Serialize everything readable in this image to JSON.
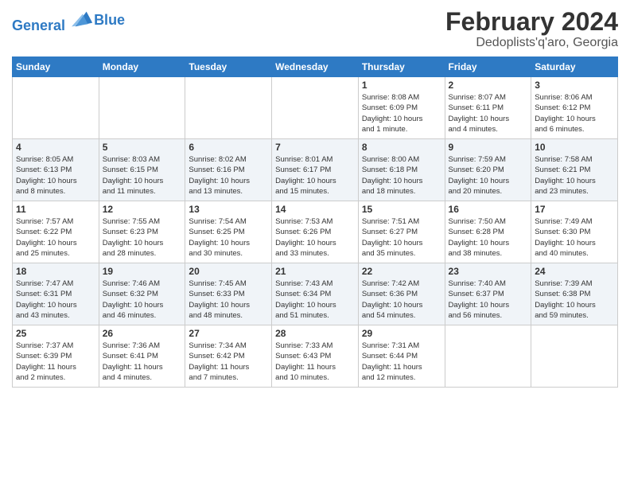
{
  "header": {
    "logo_line1": "General",
    "logo_line2": "Blue",
    "title": "February 2024",
    "subtitle": "Dedoplists'q'aro, Georgia"
  },
  "days_of_week": [
    "Sunday",
    "Monday",
    "Tuesday",
    "Wednesday",
    "Thursday",
    "Friday",
    "Saturday"
  ],
  "weeks": [
    [
      {
        "day": "",
        "info": ""
      },
      {
        "day": "",
        "info": ""
      },
      {
        "day": "",
        "info": ""
      },
      {
        "day": "",
        "info": ""
      },
      {
        "day": "1",
        "info": "Sunrise: 8:08 AM\nSunset: 6:09 PM\nDaylight: 10 hours\nand 1 minute."
      },
      {
        "day": "2",
        "info": "Sunrise: 8:07 AM\nSunset: 6:11 PM\nDaylight: 10 hours\nand 4 minutes."
      },
      {
        "day": "3",
        "info": "Sunrise: 8:06 AM\nSunset: 6:12 PM\nDaylight: 10 hours\nand 6 minutes."
      }
    ],
    [
      {
        "day": "4",
        "info": "Sunrise: 8:05 AM\nSunset: 6:13 PM\nDaylight: 10 hours\nand 8 minutes."
      },
      {
        "day": "5",
        "info": "Sunrise: 8:03 AM\nSunset: 6:15 PM\nDaylight: 10 hours\nand 11 minutes."
      },
      {
        "day": "6",
        "info": "Sunrise: 8:02 AM\nSunset: 6:16 PM\nDaylight: 10 hours\nand 13 minutes."
      },
      {
        "day": "7",
        "info": "Sunrise: 8:01 AM\nSunset: 6:17 PM\nDaylight: 10 hours\nand 15 minutes."
      },
      {
        "day": "8",
        "info": "Sunrise: 8:00 AM\nSunset: 6:18 PM\nDaylight: 10 hours\nand 18 minutes."
      },
      {
        "day": "9",
        "info": "Sunrise: 7:59 AM\nSunset: 6:20 PM\nDaylight: 10 hours\nand 20 minutes."
      },
      {
        "day": "10",
        "info": "Sunrise: 7:58 AM\nSunset: 6:21 PM\nDaylight: 10 hours\nand 23 minutes."
      }
    ],
    [
      {
        "day": "11",
        "info": "Sunrise: 7:57 AM\nSunset: 6:22 PM\nDaylight: 10 hours\nand 25 minutes."
      },
      {
        "day": "12",
        "info": "Sunrise: 7:55 AM\nSunset: 6:23 PM\nDaylight: 10 hours\nand 28 minutes."
      },
      {
        "day": "13",
        "info": "Sunrise: 7:54 AM\nSunset: 6:25 PM\nDaylight: 10 hours\nand 30 minutes."
      },
      {
        "day": "14",
        "info": "Sunrise: 7:53 AM\nSunset: 6:26 PM\nDaylight: 10 hours\nand 33 minutes."
      },
      {
        "day": "15",
        "info": "Sunrise: 7:51 AM\nSunset: 6:27 PM\nDaylight: 10 hours\nand 35 minutes."
      },
      {
        "day": "16",
        "info": "Sunrise: 7:50 AM\nSunset: 6:28 PM\nDaylight: 10 hours\nand 38 minutes."
      },
      {
        "day": "17",
        "info": "Sunrise: 7:49 AM\nSunset: 6:30 PM\nDaylight: 10 hours\nand 40 minutes."
      }
    ],
    [
      {
        "day": "18",
        "info": "Sunrise: 7:47 AM\nSunset: 6:31 PM\nDaylight: 10 hours\nand 43 minutes."
      },
      {
        "day": "19",
        "info": "Sunrise: 7:46 AM\nSunset: 6:32 PM\nDaylight: 10 hours\nand 46 minutes."
      },
      {
        "day": "20",
        "info": "Sunrise: 7:45 AM\nSunset: 6:33 PM\nDaylight: 10 hours\nand 48 minutes."
      },
      {
        "day": "21",
        "info": "Sunrise: 7:43 AM\nSunset: 6:34 PM\nDaylight: 10 hours\nand 51 minutes."
      },
      {
        "day": "22",
        "info": "Sunrise: 7:42 AM\nSunset: 6:36 PM\nDaylight: 10 hours\nand 54 minutes."
      },
      {
        "day": "23",
        "info": "Sunrise: 7:40 AM\nSunset: 6:37 PM\nDaylight: 10 hours\nand 56 minutes."
      },
      {
        "day": "24",
        "info": "Sunrise: 7:39 AM\nSunset: 6:38 PM\nDaylight: 10 hours\nand 59 minutes."
      }
    ],
    [
      {
        "day": "25",
        "info": "Sunrise: 7:37 AM\nSunset: 6:39 PM\nDaylight: 11 hours\nand 2 minutes."
      },
      {
        "day": "26",
        "info": "Sunrise: 7:36 AM\nSunset: 6:41 PM\nDaylight: 11 hours\nand 4 minutes."
      },
      {
        "day": "27",
        "info": "Sunrise: 7:34 AM\nSunset: 6:42 PM\nDaylight: 11 hours\nand 7 minutes."
      },
      {
        "day": "28",
        "info": "Sunrise: 7:33 AM\nSunset: 6:43 PM\nDaylight: 11 hours\nand 10 minutes."
      },
      {
        "day": "29",
        "info": "Sunrise: 7:31 AM\nSunset: 6:44 PM\nDaylight: 11 hours\nand 12 minutes."
      },
      {
        "day": "",
        "info": ""
      },
      {
        "day": "",
        "info": ""
      }
    ]
  ]
}
